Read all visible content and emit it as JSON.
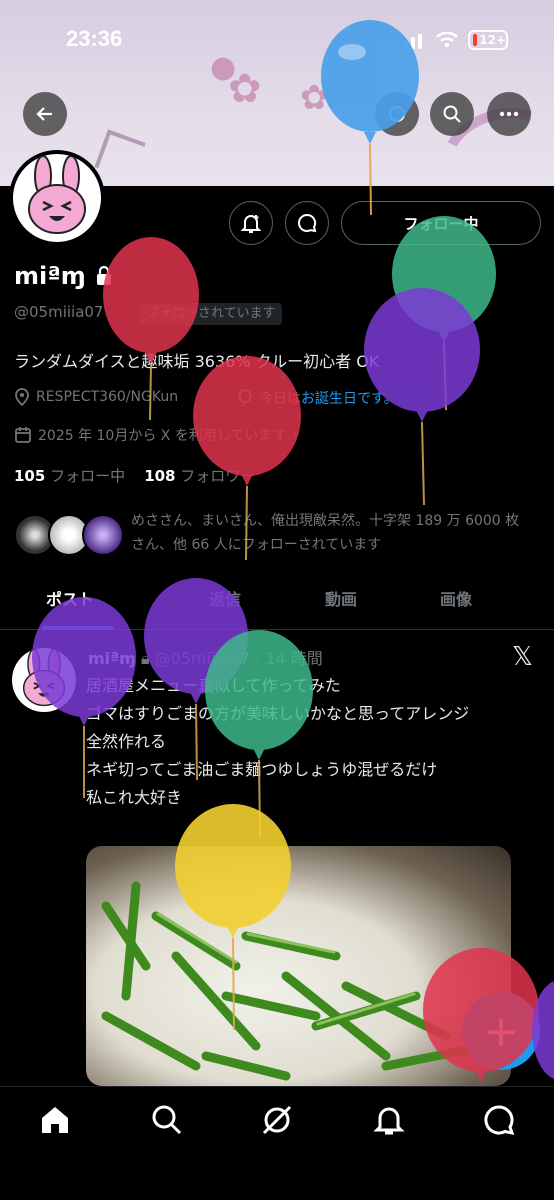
{
  "status_bar": {
    "time": "23:36",
    "battery": "12+"
  },
  "header": {
    "buttons": [
      "back-icon",
      "share-icon",
      "search-icon",
      "more-icon"
    ]
  },
  "profile": {
    "name": "miªɱ",
    "handle": "@05miiia07",
    "follows_you": "フォローされています",
    "follow_label": "フォロー中",
    "bio": "ランダムダイスと趣味垢 3636% クルー初心者 OK",
    "location": "RESPECT360/NGKun",
    "birthday_prefix": "今日は",
    "birthday_link": "お誕生日です。",
    "joined": "2025 年 10月から X を利用しています",
    "following_count": "105",
    "following_label": "フォロー中",
    "followers_count": "108",
    "followers_label": "フォロワー",
    "followed_by": "めささん、まいさん、俺出現敵呆然。十字架 189 万 6000 枚さん、他 66 人にフォローされています"
  },
  "tabs": [
    {
      "label": "ポスト"
    },
    {
      "label": "返信"
    },
    {
      "label": "動画"
    },
    {
      "label": "画像"
    }
  ],
  "post": {
    "name": "miªɱ",
    "meta": "@05miiia07 · 14 時間",
    "lines": [
      "居酒屋メニュー真似して作ってみた",
      "ゴマはすりごまの方が美味しいかなと思ってアレンジ",
      "全然作れる",
      "ネギ切ってごま油ごま麺つゆしょうゆ混ぜるだけ",
      "私これ大好き"
    ]
  },
  "fab_label": "+",
  "bottom_nav": [
    "home-icon",
    "search-icon",
    "grok-icon",
    "notifications-icon",
    "messages-icon"
  ],
  "colors": {
    "accent": "#1d9bf0",
    "background": "#000000",
    "muted": "#71767b"
  }
}
